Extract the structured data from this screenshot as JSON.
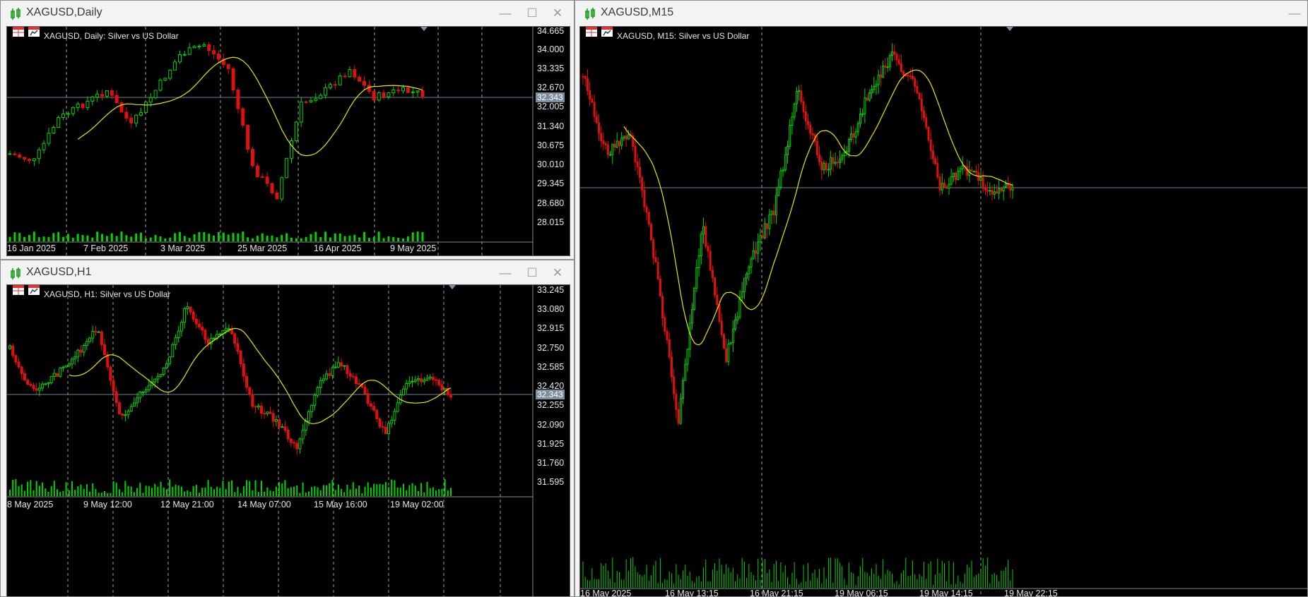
{
  "colors": {
    "up": "#00d400",
    "down": "#e11010",
    "ma": "#e8e800",
    "bg": "#000000",
    "grid": "#a0a0a0",
    "priceLine": "#6f8296",
    "highlight": "#ff1e1e"
  },
  "windows": {
    "daily": {
      "title": "XAGUSD,Daily",
      "chart_label": "XAGUSD, Daily:  Silver vs US Dollar",
      "current_price": "32.343",
      "price_axis": [
        "34.665",
        "34.000",
        "33.335",
        "32.670",
        "32.005",
        "31.340",
        "30.675",
        "30.010",
        "29.345",
        "28.680",
        "28.015"
      ],
      "time_axis": [
        "16 Jan 2025",
        "7 Feb 2025",
        "3 Mar 2025",
        "25 Mar 2025",
        "16 Apr 2025",
        "9 May 2025"
      ]
    },
    "h1": {
      "title": "XAGUSD,H1",
      "chart_label": "XAGUSD, H1:  Silver vs US Dollar",
      "current_price": "32.343",
      "price_axis": [
        "33.245",
        "33.080",
        "32.915",
        "32.750",
        "32.585",
        "32.420",
        "32.255",
        "32.090",
        "31.925",
        "31.760",
        "31.595"
      ],
      "time_axis": [
        "8 May 2025",
        "9 May 12:00",
        "12 May 21:00",
        "14 May 07:00",
        "15 May 16:00",
        "19 May 02:00"
      ]
    },
    "m15": {
      "title": "XAGUSD,M15",
      "chart_label": "XAGUSD, M15:  Silver vs US Dollar",
      "time_axis": [
        "16 May 2025",
        "16 May 13:15",
        "16 May 21:15",
        "19 May 06:15",
        "19 May 14:15",
        "19 May 22:15"
      ]
    }
  },
  "window_controls": {
    "minimize": "—",
    "maximize": "☐",
    "close": "✕"
  }
}
